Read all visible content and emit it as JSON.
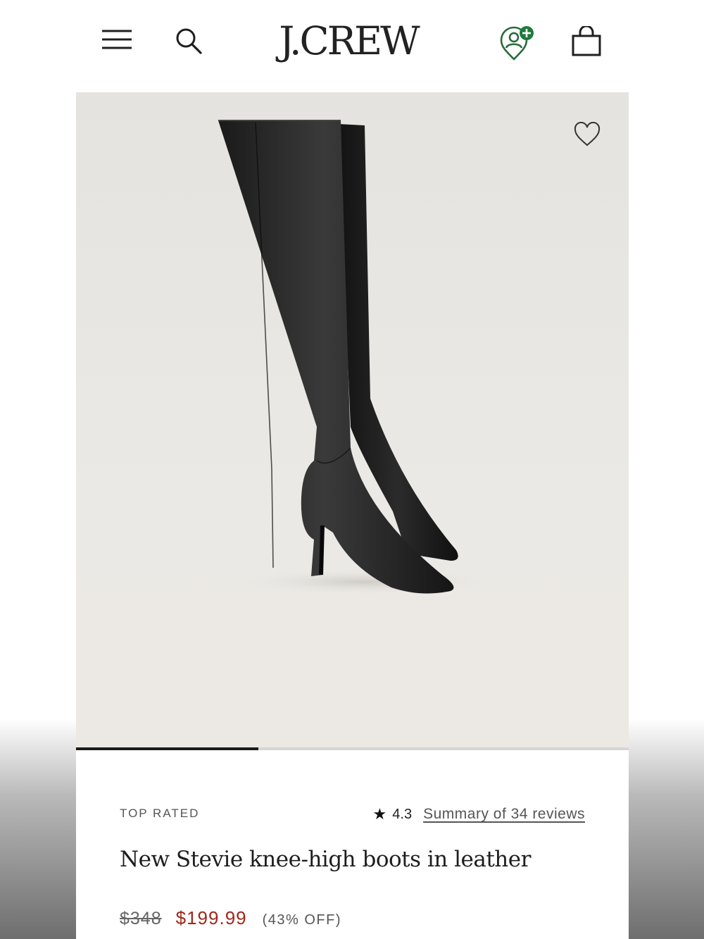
{
  "header": {
    "brand": "J.CREW",
    "menu_icon": "menu-icon",
    "search_icon": "search-icon",
    "account_icon": "account-add-icon",
    "bag_icon": "shopping-bag-icon"
  },
  "gallery": {
    "image": "black knee-high leather boots",
    "favorite_icon": "heart-outline-icon",
    "progress": 0.33
  },
  "product": {
    "badge": "TOP RATED",
    "star_icon": "star-icon",
    "rating": "4.3",
    "reviews_link": "Summary of 34 reviews",
    "name": "New Stevie knee-high boots in leather",
    "original_price": "$348",
    "sale_price": "$199.99",
    "discount": "(43% OFF)"
  },
  "colors": {
    "sale": "#a0271b",
    "account_badge": "#1f7a3d"
  }
}
